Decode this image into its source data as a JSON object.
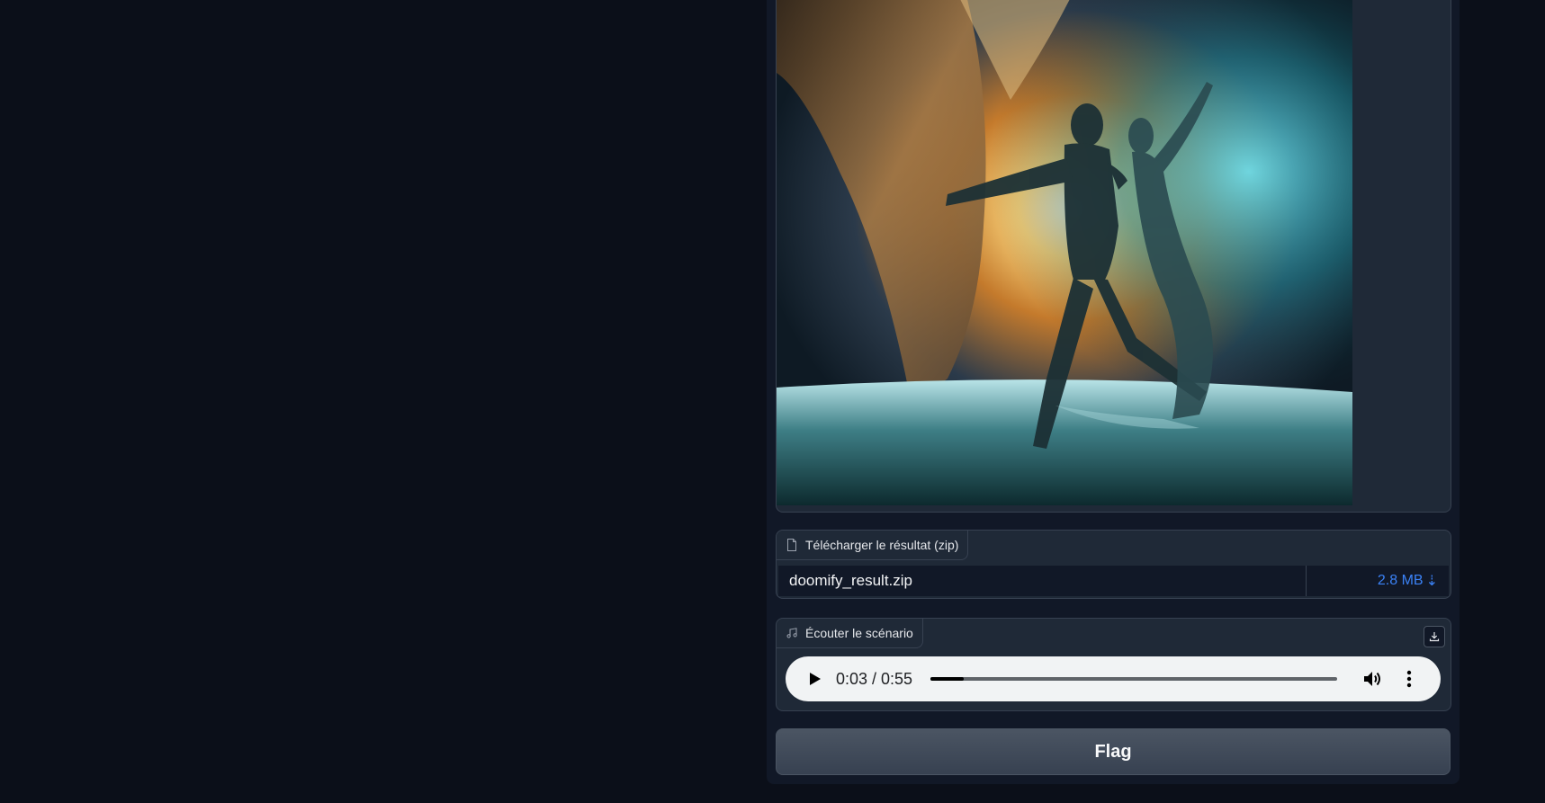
{
  "image_output": {
    "alt": "Generated image of two figures dancing on water before a stormy sky"
  },
  "file_output": {
    "label": "Télécharger le résultat (zip)",
    "file_name": "doomify_result.zip",
    "file_size": "2.8 MB",
    "download_glyph": "⇣",
    "icon": "file-icon"
  },
  "audio_output": {
    "label": "Écouter le scénario",
    "icon": "music-icon",
    "time": "0:03 / 0:55",
    "progress_fraction": 0.081
  },
  "flag_button": {
    "label": "Flag"
  },
  "colors": {
    "background": "#0b0f19",
    "panel": "#111827",
    "block": "#1f2937",
    "accent_link": "#3b82f6"
  }
}
